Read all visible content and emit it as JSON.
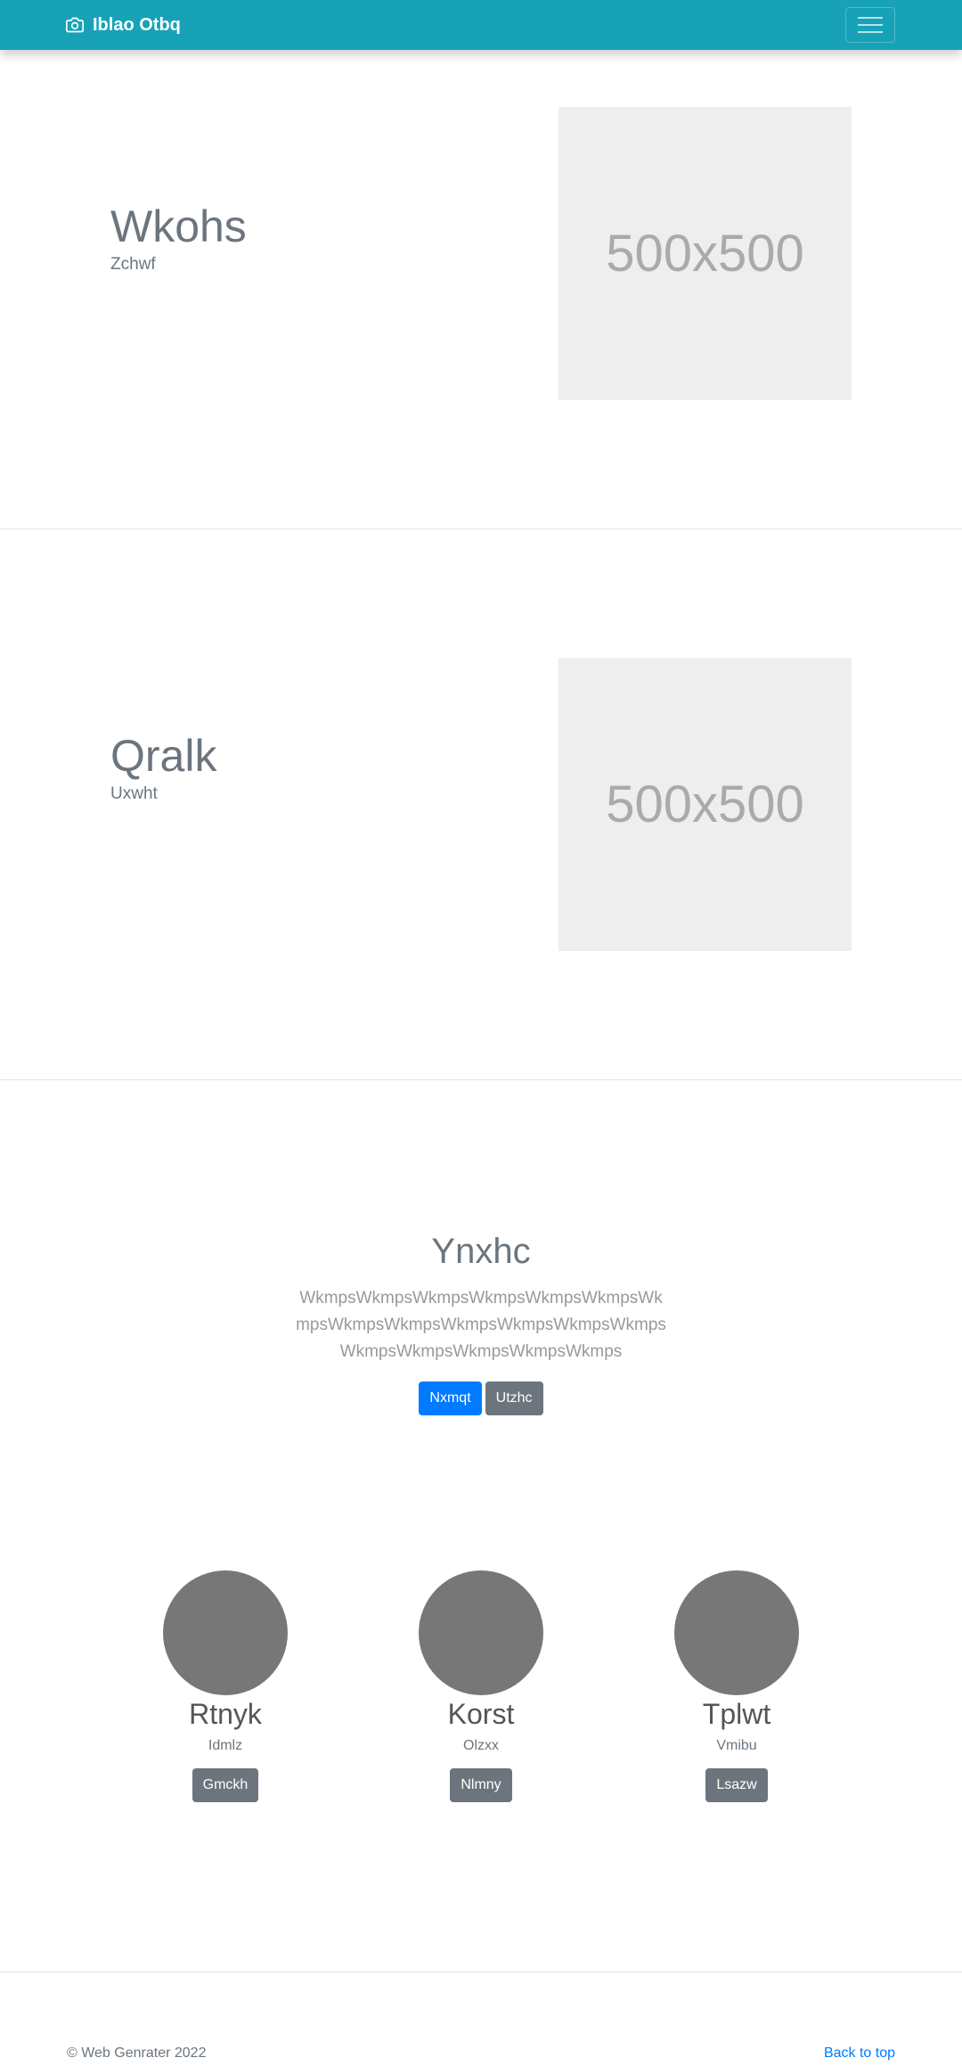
{
  "navbar": {
    "brand": "Iblao Otbq",
    "brand_icon": "camera-icon",
    "toggler_icon": "hamburger-menu-icon",
    "background": "#17a2b8"
  },
  "features": [
    {
      "heading": "Wkohs",
      "subheading": "Zchwf",
      "image_label": "500x500"
    },
    {
      "heading": "Qralk",
      "subheading": "Uxwht",
      "image_label": "500x500"
    }
  ],
  "jumbotron": {
    "heading": "Ynxhc",
    "lead": "WkmpsWkmpsWkmpsWkmpsWkmpsWkmpsWkmpsWkmpsWkmpsWkmpsWkmpsWkmpsWkmpsWkmpsWkmpsWkmpsWkmpsWkmps",
    "primary_button": "Nxmqt",
    "secondary_button": "Utzhc"
  },
  "cards": [
    {
      "name": "Rtnyk",
      "role": "Idmlz",
      "button": "Gmckh"
    },
    {
      "name": "Korst",
      "role": "Olzxx",
      "button": "Nlmny"
    },
    {
      "name": "Tplwt",
      "role": "Vmibu",
      "button": "Lsazw"
    }
  ],
  "footer": {
    "copyright": "© Web Genrater 2022",
    "back_to_top": "Back to top"
  },
  "colors": {
    "primary": "#007bff",
    "secondary": "#6c757d",
    "placeholder_bg": "#eeeeee",
    "avatar": "#777777"
  }
}
